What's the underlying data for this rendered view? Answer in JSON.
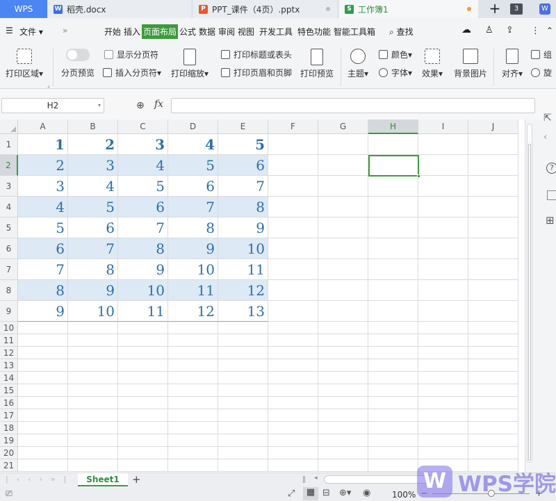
{
  "tabs": [
    {
      "label": "WPS",
      "active": false
    },
    {
      "label": "稻壳.docx",
      "active": false
    },
    {
      "label": "PPT_课件（4页）.pptx",
      "active": false
    },
    {
      "label": "工作簿1",
      "active": true
    }
  ],
  "tab_counter": "3",
  "menu": {
    "file": "文件",
    "items": [
      "开始",
      "插入",
      "页面布局",
      "公式",
      "数据",
      "审阅",
      "视图",
      "开发工具",
      "特色功能",
      "智能工具箱"
    ],
    "active": "页面布局",
    "search": "查找"
  },
  "ribbon": {
    "print_area": "打印区域",
    "page_break_preview": "分页预览",
    "show_page_breaks": "显示分页符",
    "insert_page_break": "插入分页符",
    "print_scale": "打印缩放",
    "print_titles": "打印标题或表头",
    "print_header_footer": "打印页眉和页脚",
    "print_preview": "打印预览",
    "theme": "主题",
    "colors": "颜色",
    "fonts": "字体",
    "effects": "效果",
    "background": "背景图片",
    "align": "对齐",
    "group": "组",
    "rotate": "旋"
  },
  "formula_bar": {
    "name_box": "H2",
    "fx": "fx",
    "value": ""
  },
  "columns": [
    "A",
    "B",
    "C",
    "D",
    "E",
    "F",
    "G",
    "H",
    "I",
    "J"
  ],
  "rows": [
    "1",
    "2",
    "3",
    "4",
    "5",
    "6",
    "7",
    "8",
    "9",
    "10",
    "11",
    "12",
    "13",
    "14",
    "15",
    "16",
    "17",
    "18",
    "19",
    "20",
    "21"
  ],
  "cells": [
    [
      "1",
      "2",
      "3",
      "4",
      "5"
    ],
    [
      "2",
      "3",
      "4",
      "5",
      "6"
    ],
    [
      "3",
      "4",
      "5",
      "6",
      "7"
    ],
    [
      "4",
      "5",
      "6",
      "7",
      "8"
    ],
    [
      "5",
      "6",
      "7",
      "8",
      "9"
    ],
    [
      "6",
      "7",
      "8",
      "9",
      "10"
    ],
    [
      "7",
      "8",
      "9",
      "10",
      "11"
    ],
    [
      "8",
      "9",
      "10",
      "11",
      "12"
    ],
    [
      "9",
      "10",
      "11",
      "12",
      "13"
    ]
  ],
  "selected_cell": "H2",
  "sheet": {
    "name": "Sheet1",
    "add": "+"
  },
  "status": {
    "zoom": "100%"
  },
  "watermark": "WPS学院",
  "colors": {
    "accent": "#3c9a3c",
    "cell_text": "#2e6fad",
    "band": "#dde9f5",
    "header_sel": "#d4d7dc"
  }
}
